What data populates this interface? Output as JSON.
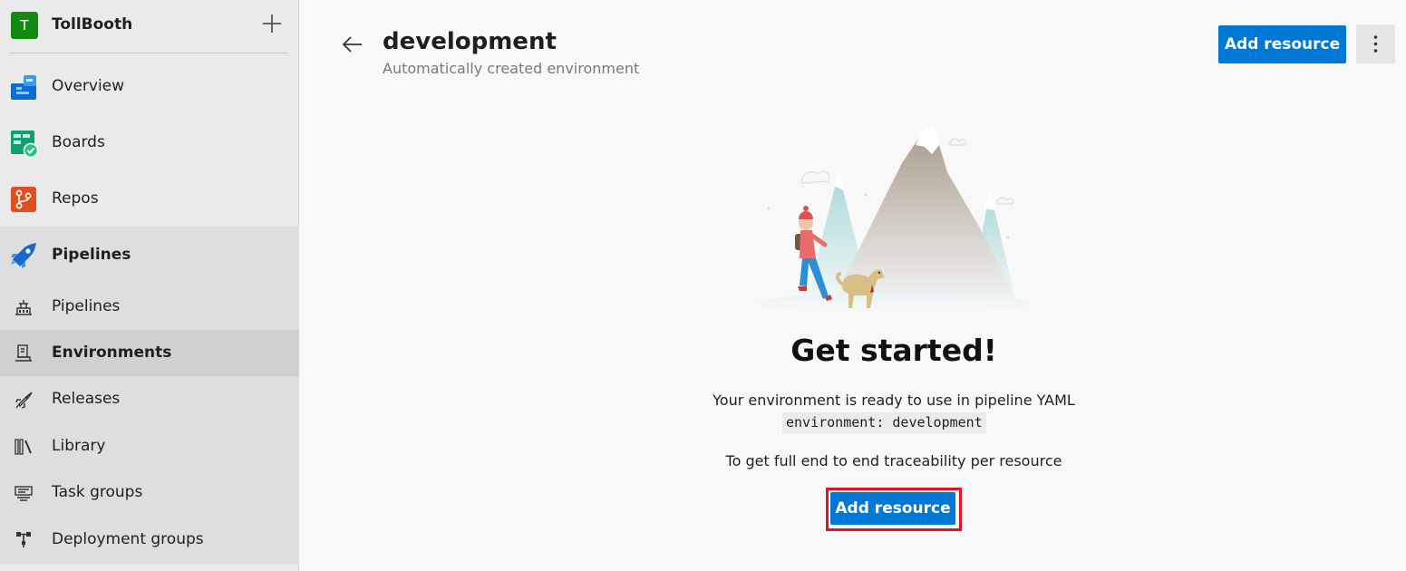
{
  "project": {
    "initial": "T",
    "name": "TollBooth"
  },
  "nav": [
    {
      "label": "Overview"
    },
    {
      "label": "Boards"
    },
    {
      "label": "Repos"
    },
    {
      "label": "Pipelines"
    }
  ],
  "pipelines_sub": [
    {
      "label": "Pipelines"
    },
    {
      "label": "Environments"
    },
    {
      "label": "Releases"
    },
    {
      "label": "Library"
    },
    {
      "label": "Task groups"
    },
    {
      "label": "Deployment groups"
    }
  ],
  "header": {
    "title": "development",
    "subtitle": "Automatically created environment",
    "add_resource_label": "Add resource"
  },
  "empty_state": {
    "heading": "Get started!",
    "ready_text": "Your environment is ready to use in pipeline YAML",
    "code": "environment: development",
    "trace_text": "To get full end to end traceability per resource",
    "button_label": "Add resource"
  },
  "colors": {
    "accent": "#0078d4",
    "project_avatar": "#128a12",
    "highlight_border": "#e81123"
  },
  "icons": {
    "overview": "overview-icon",
    "boards": "boards-icon",
    "repos": "repos-icon",
    "pipelines": "pipelines-icon",
    "back": "arrow-left-icon",
    "more": "more-vertical-icon",
    "add": "plus-icon"
  }
}
